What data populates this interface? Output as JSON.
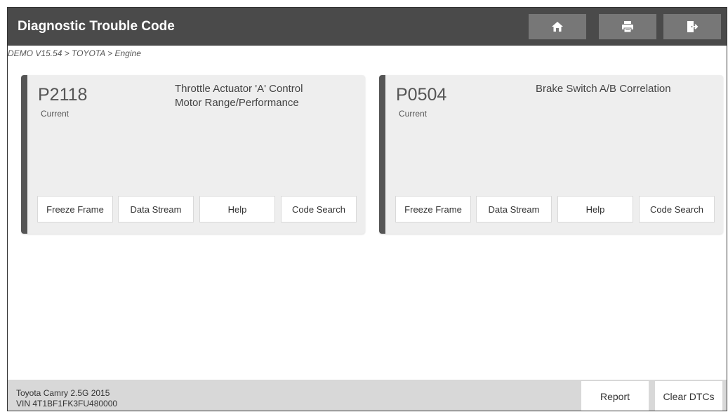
{
  "header": {
    "title": "Diagnostic Trouble Code",
    "buttons": [
      {
        "icon": "home-icon"
      },
      {
        "icon": "print-icon"
      },
      {
        "icon": "exit-icon"
      }
    ]
  },
  "breadcrumb": "DEMO V15.54 > TOYOTA > Engine",
  "dtcs": [
    {
      "code": "P2118",
      "status": "Current",
      "description_line1": "Throttle Actuator 'A' Control",
      "description_line2": "Motor Range/Performance",
      "buttons": [
        "Freeze Frame",
        "Data Stream",
        "Help",
        "Code Search"
      ]
    },
    {
      "code": "P0504",
      "status": "Current",
      "description_line1": "Brake Switch A/B Correlation",
      "description_line2": "",
      "buttons": [
        "Freeze Frame",
        "Data Stream",
        "Help",
        "Code Search"
      ]
    }
  ],
  "footer": {
    "vehicle": "Toyota Camry 2.5G 2015",
    "vin": "VIN 4T1BF1FK3FU480000",
    "report_label": "Report",
    "clear_label": "Clear DTCs"
  },
  "colors": {
    "titlebar": "#4a4a4a",
    "card_background": "#eeeeee",
    "card_accent": "#555555",
    "footer": "#d8d8d8"
  }
}
